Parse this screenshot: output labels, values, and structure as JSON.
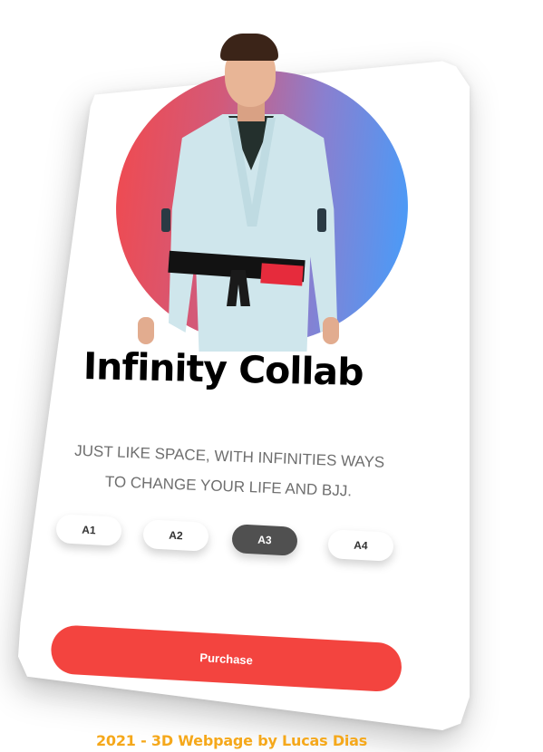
{
  "product": {
    "title": "Infinity Collab",
    "tagline_line1": "JUST LIKE SPACE, WITH INFINITIES WAYS",
    "tagline_line2": "TO CHANGE YOUR LIFE AND BJJ."
  },
  "sizes": {
    "options": [
      "A1",
      "A2",
      "A3",
      "A4"
    ],
    "selected": "A3"
  },
  "purchase": {
    "label": "Purchase"
  },
  "footer": {
    "credit": "2021 - 3D Webpage by Lucas Dias"
  },
  "colors": {
    "accent": "#f3443f",
    "gradient_start": "#f4484a",
    "gradient_end": "#3fa0ff",
    "selected_size": "#505050",
    "footer_text": "#f5a81b"
  }
}
